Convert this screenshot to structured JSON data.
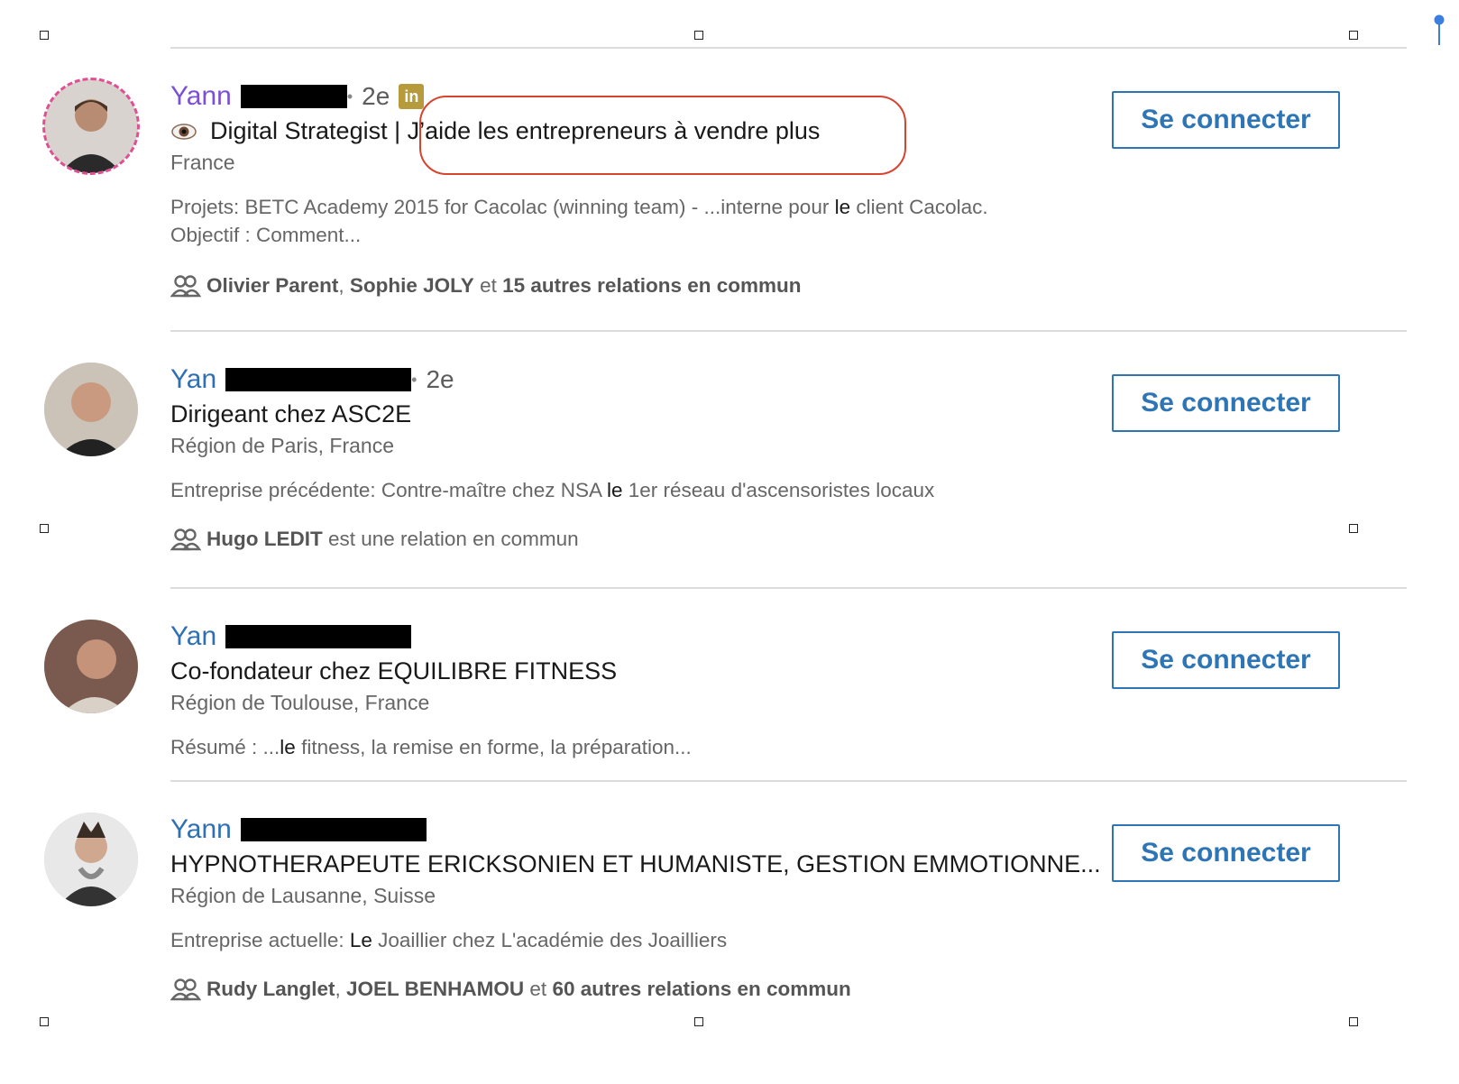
{
  "results": [
    {
      "name": "Yann",
      "degree": "2e",
      "badge": "in",
      "headline_before": "Digital Strategist |",
      "headline_highlight": "J’aide les entrepreneurs à vendre plus",
      "location": "France",
      "snippet_parts": [
        "Projets: BETC Academy 2015 for Cacolac (winning team) - ...interne pour ",
        "le",
        " client Cacolac.",
        "Objectif : Comment..."
      ],
      "shared_names": [
        "Olivier Parent",
        "Sophie JOLY"
      ],
      "shared_joiner": "et",
      "shared_count": "15 autres relations en commun",
      "connect_label": "Se connecter"
    },
    {
      "name": "Yan",
      "degree": "2e",
      "headline": "Dirigeant chez ASC2E",
      "location": "Région de Paris, France",
      "snippet_parts": [
        "Entreprise précédente: Contre-maître chez NSA ",
        "le",
        " 1er réseau d'ascensoristes locaux"
      ],
      "shared_names": [
        "Hugo LEDIT"
      ],
      "shared_text": "est une relation en commun",
      "connect_label": "Se connecter"
    },
    {
      "name": "Yan",
      "headline": "Co-fondateur chez EQUILIBRE FITNESS",
      "location": "Région de Toulouse, France",
      "snippet_parts": [
        "Résumé : ...",
        "le",
        " fitness, la remise en forme, la préparation..."
      ],
      "connect_label": "Se connecter"
    },
    {
      "name": "Yann",
      "headline": "HYPNOTHERAPEUTE ERICKSONIEN ET HUMANISTE, GESTION EMMOTIONNE...",
      "location": "Région de Lausanne, Suisse",
      "snippet_parts": [
        "Entreprise actuelle: ",
        "Le",
        " Joaillier chez L'académie des Joailliers"
      ],
      "shared_names": [
        "Rudy Langlet",
        "JOEL BENHAMOU"
      ],
      "shared_joiner": "et",
      "shared_count": "60 autres relations en commun",
      "connect_label": "Se connecter"
    }
  ],
  "icons": {
    "shared": "people-icon",
    "headline_emoji": "eye-icon",
    "pin": "pin-icon"
  },
  "colors": {
    "link": "#2f6fb3",
    "visited_link": "#7b4fd6",
    "button": "#2e75b6",
    "oval": "#d6432f"
  }
}
